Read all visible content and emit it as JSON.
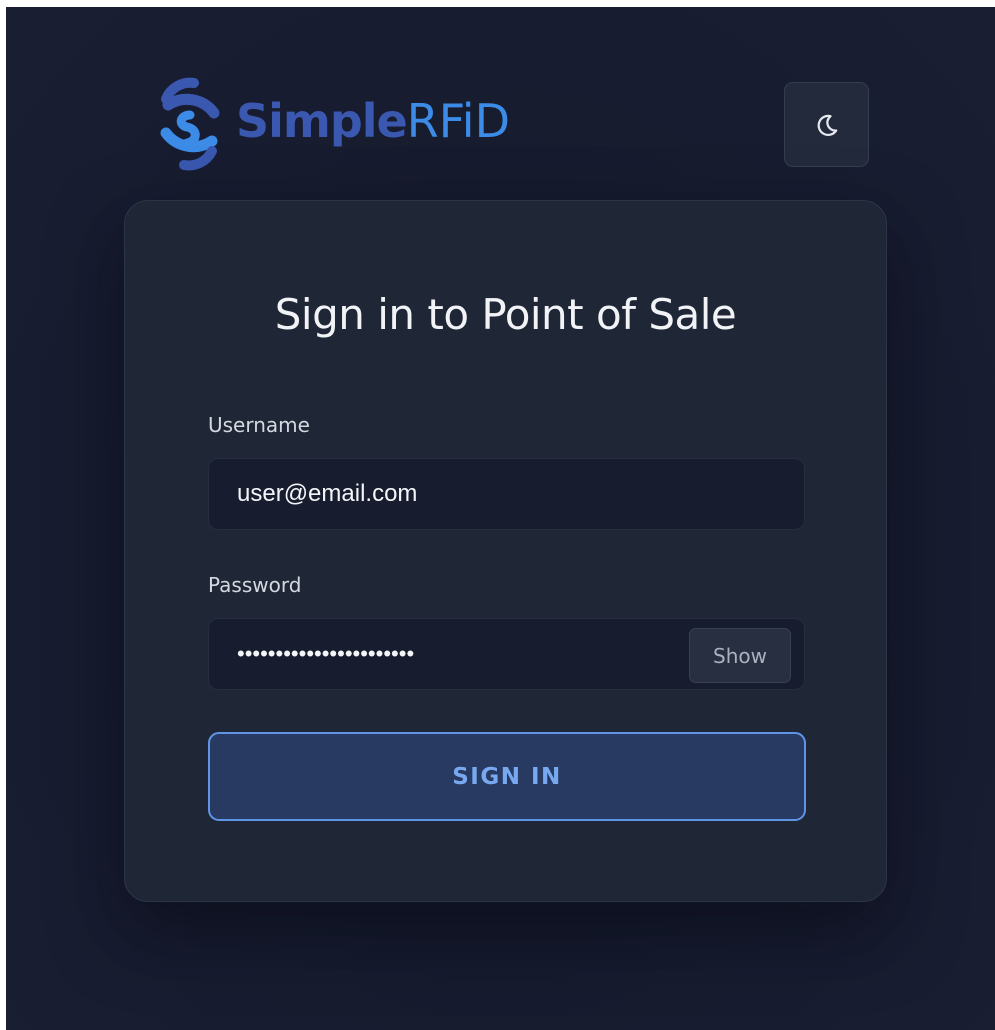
{
  "brand": {
    "name_part1": "Simple",
    "name_part2": "RFiD",
    "color_primary": "#3a58b0",
    "color_secondary": "#3c8be6"
  },
  "header": {
    "theme_toggle_icon": "moon-icon"
  },
  "login": {
    "title": "Sign in to Point of Sale",
    "username_label": "Username",
    "username_value": "user@email.com",
    "password_label": "Password",
    "password_value": "•••••••••••••••••••••••",
    "show_label": "Show",
    "submit_label": "SIGN IN",
    "accent_color": "#5f95e6"
  }
}
